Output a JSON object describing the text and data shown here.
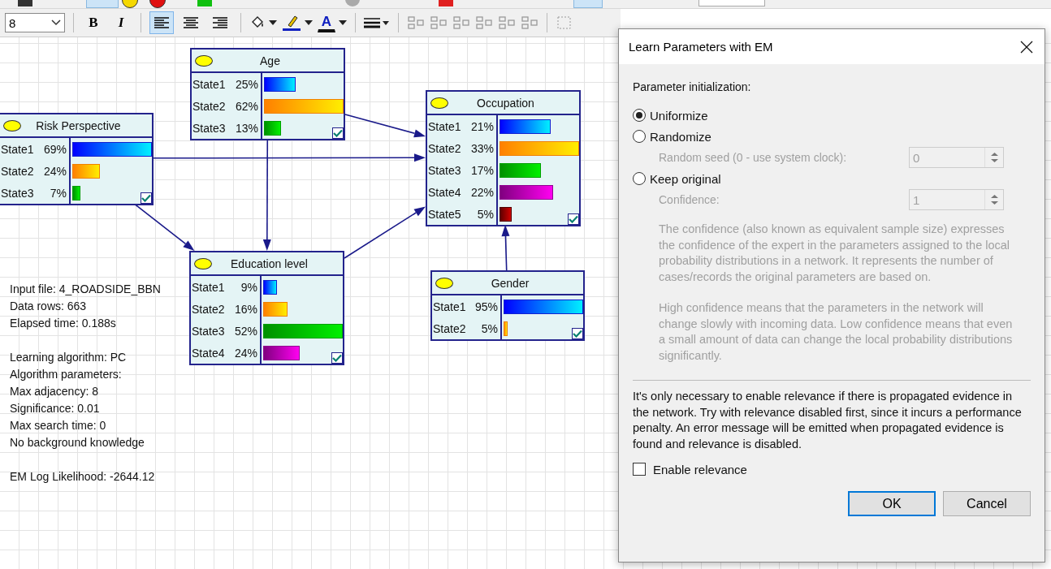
{
  "toolbar": {
    "font_size": "8",
    "bold": "B",
    "italic": "I",
    "align": [
      {
        "selected": true
      },
      {
        "selected": false
      },
      {
        "selected": false
      }
    ],
    "font_color": "A"
  },
  "nodes": [
    {
      "title": "Risk Perspective",
      "checked": true,
      "states": [
        {
          "name": "State1",
          "value": "69%",
          "level": 1
        },
        {
          "name": "State2",
          "value": "24%",
          "level": 0.35
        },
        {
          "name": "State3",
          "value": "7%",
          "level": 0.1
        }
      ]
    },
    {
      "title": "Age",
      "checked": true,
      "states": [
        {
          "name": "State1",
          "value": "25%",
          "level": 0.4
        },
        {
          "name": "State2",
          "value": "62%",
          "level": 1
        },
        {
          "name": "State3",
          "value": "13%",
          "level": 0.21
        }
      ]
    },
    {
      "title": "Occupation",
      "checked": true,
      "states": [
        {
          "name": "State1",
          "value": "21%",
          "level": 0.64
        },
        {
          "name": "State2",
          "value": "33%",
          "level": 1
        },
        {
          "name": "State3",
          "value": "17%",
          "level": 0.52
        },
        {
          "name": "State4",
          "value": "22%",
          "level": 0.67
        },
        {
          "name": "State5",
          "value": "5%",
          "level": 0.15
        }
      ]
    },
    {
      "title": "Education level",
      "checked": true,
      "states": [
        {
          "name": "State1",
          "value": "9%",
          "level": 0.17
        },
        {
          "name": "State2",
          "value": "16%",
          "level": 0.31
        },
        {
          "name": "State3",
          "value": "52%",
          "level": 1
        },
        {
          "name": "State4",
          "value": "24%",
          "level": 0.46
        }
      ]
    },
    {
      "title": "Gender",
      "checked": true,
      "states": [
        {
          "name": "State1",
          "value": "95%",
          "level": 1
        },
        {
          "name": "State2",
          "value": "5%",
          "level": 0.05
        }
      ]
    }
  ],
  "run_info": [
    [
      "Input file: 4_ROADSIDE_BBN",
      "Data rows: 663",
      "Elapsed time: 0.188s"
    ],
    [
      "Learning algorithm: PC",
      "Algorithm parameters:",
      "Max adjacency: 8",
      "Significance: 0.01",
      "Max search time: 0",
      "No background knowledge"
    ],
    [
      "EM Log Likelihood: -2644.12"
    ]
  ],
  "dialog": {
    "title": "Learn Parameters with EM",
    "init_label": "Parameter initialization:",
    "options": [
      {
        "label": "Uniformize",
        "selected": true
      },
      {
        "label": "Randomize",
        "selected": false
      },
      {
        "label": "Keep original",
        "selected": false
      }
    ],
    "random_seed": {
      "label": "Random seed (0 - use system clock):",
      "value": "0",
      "disabled": true
    },
    "confidence": {
      "label": "Confidence:",
      "value": "1",
      "disabled": true
    },
    "notes": [
      "The confidence (also known as equivalent sample size) expresses the confidence of the expert in the parameters assigned to the local probability distributions in a network. It represents the number of cases/records the original parameters are based on.",
      "High confidence means that the parameters in the network will change slowly with incoming data. Low confidence means that even a small amount of data can change the local probability distributions significantly."
    ],
    "relevance_note": "It's only necessary to enable relevance if there is propagated evidence in the network. Try with relevance disabled first, since it incurs a performance penalty. An error message will be emitted when propagated evidence is found and relevance is disabled.",
    "enable_relevance": {
      "label": "Enable relevance",
      "checked": false
    },
    "buttons": [
      {
        "label": "OK",
        "default": true
      },
      {
        "label": "Cancel",
        "default": false
      }
    ]
  }
}
